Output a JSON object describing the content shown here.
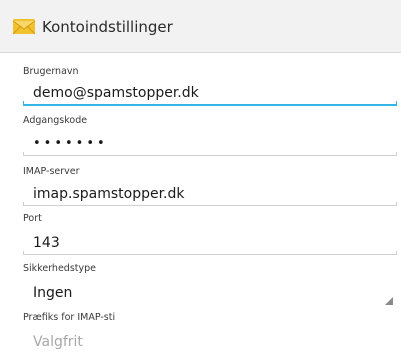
{
  "header": {
    "title": "Kontoindstillinger",
    "icon": "envelope-icon",
    "icon_color": "#f2c12e"
  },
  "fields": {
    "username": {
      "label": "Brugernavn",
      "value": "demo@spamstopper.dk"
    },
    "password": {
      "label": "Adgangskode",
      "value": "•••••••"
    },
    "imap_server": {
      "label": "IMAP-server",
      "value": "imap.spamstopper.dk"
    },
    "port": {
      "label": "Port",
      "value": "143"
    },
    "security_type": {
      "label": "Sikkerhedstype",
      "value": "Ingen"
    },
    "imap_prefix": {
      "label": "Præfiks for IMAP-sti",
      "placeholder": "Valgfrit"
    }
  },
  "colors": {
    "focus_accent": "#33b5e5",
    "underline": "#cfcfcf"
  }
}
